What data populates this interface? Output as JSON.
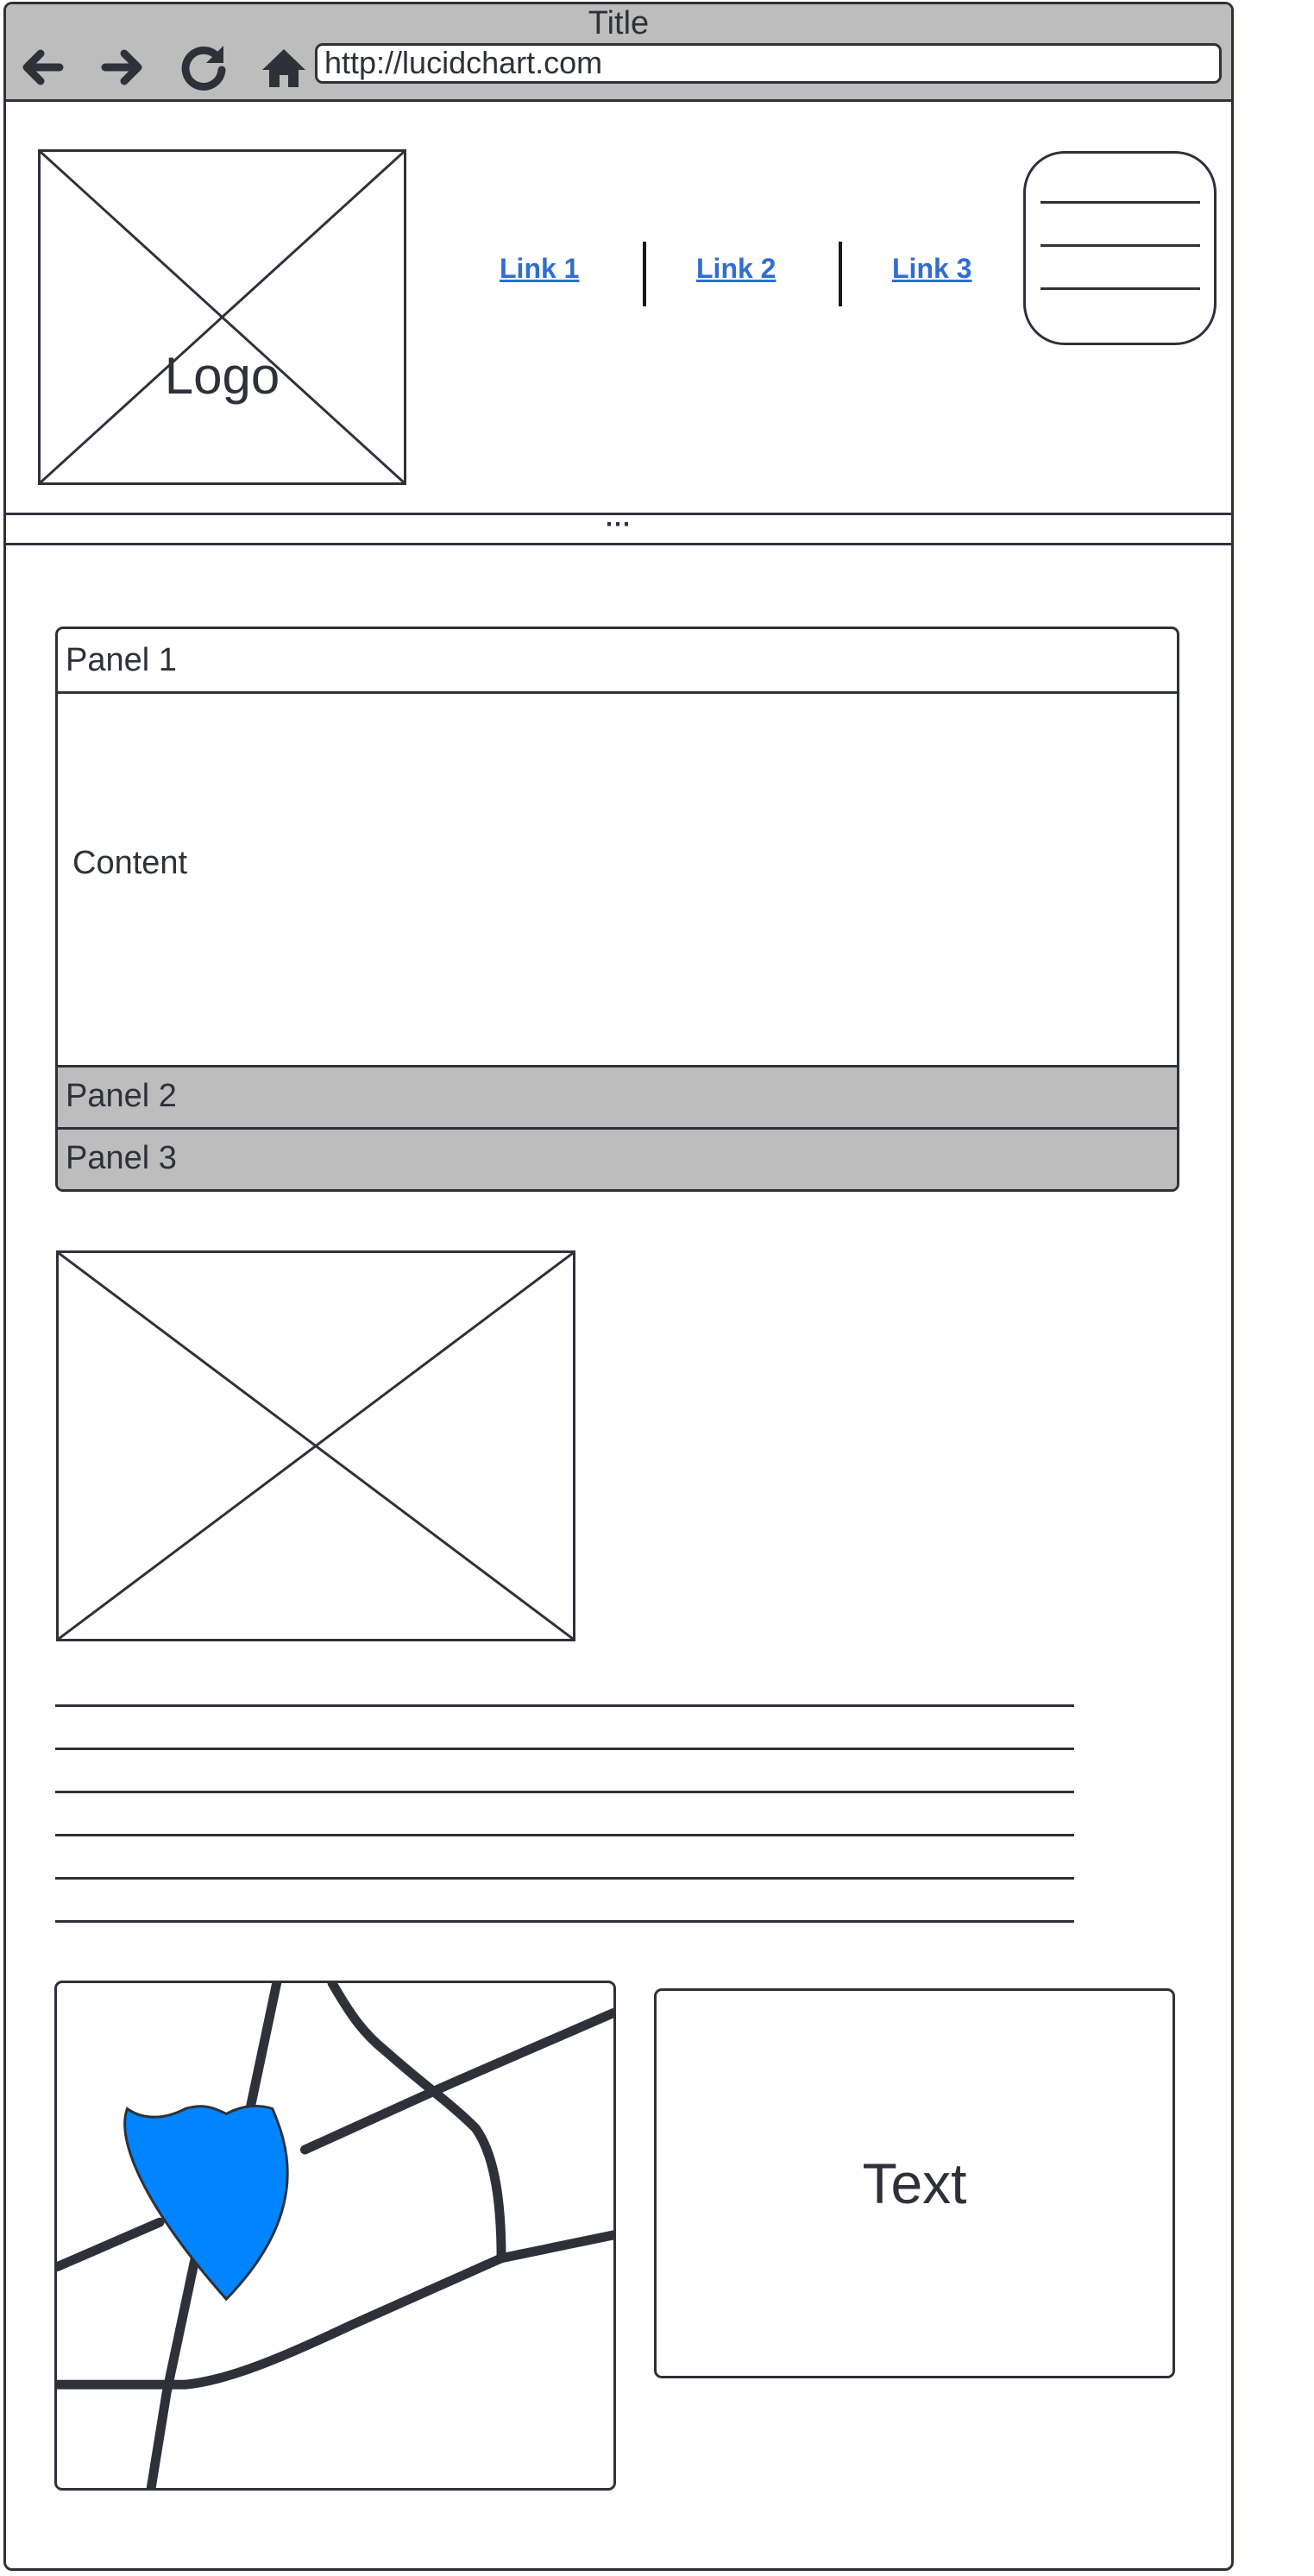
{
  "window": {
    "title": "Title",
    "url": "http://lucidchart.com",
    "nav_icons": [
      "back-arrow-icon",
      "forward-arrow-icon",
      "reload-icon",
      "home-icon"
    ]
  },
  "header": {
    "logo_label": "Logo",
    "links": [
      "Link 1",
      "Link 2",
      "Link 3"
    ],
    "menu_icon": "hamburger-icon"
  },
  "divider": {
    "label": "⋯"
  },
  "accordion": {
    "panels": [
      {
        "title": "Panel 1",
        "content": "Content",
        "expanded": true
      },
      {
        "title": "Panel 2",
        "expanded": false
      },
      {
        "title": "Panel 3",
        "expanded": false
      }
    ]
  },
  "image_placeholder": {
    "icon": "image-placeholder-icon"
  },
  "text_block": {
    "line_count": 6
  },
  "map": {
    "icon": "map-icon",
    "marker_color": "#0084ff"
  },
  "text_box": {
    "label": "Text"
  },
  "colors": {
    "ink": "#2e3139",
    "toolbar_bg": "#bdbdbd",
    "link": "#2f6ed0"
  }
}
